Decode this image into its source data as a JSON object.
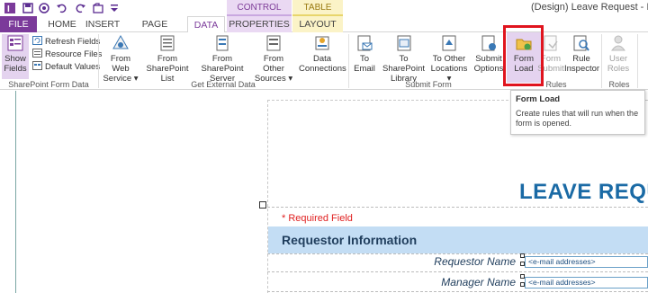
{
  "window": {
    "title": "(Design) Leave Request - Inf"
  },
  "contextual": {
    "control_tools": "CONTROL TOOLS",
    "table_tools": "TABLE TOOLS"
  },
  "tabs": {
    "file": "FILE",
    "home": "HOME",
    "insert": "INSERT",
    "page_design": "PAGE DESIGN",
    "data": "DATA",
    "properties": "PROPERTIES",
    "layout": "LAYOUT"
  },
  "ribbon": {
    "show_fields": [
      "Show",
      "Fields"
    ],
    "refresh_fields": "Refresh Fields",
    "resource_files": "Resource Files",
    "default_values": "Default Values",
    "group_sharepoint_form_data": "SharePoint Form Data",
    "from_web_service": [
      "From Web",
      "Service ▾"
    ],
    "from_sharepoint_list": [
      "From",
      "SharePoint List"
    ],
    "from_sharepoint_server": [
      "From SharePoint",
      "Server"
    ],
    "from_other_sources": [
      "From Other",
      "Sources ▾"
    ],
    "data_connections": [
      "Data",
      "Connections"
    ],
    "group_get_external_data": "Get External Data",
    "to_email": [
      "To",
      "Email"
    ],
    "to_sharepoint_library": [
      "To SharePoint",
      "Library"
    ],
    "to_other_locations": [
      "To Other",
      "Locations ▾"
    ],
    "submit_options": [
      "Submit",
      "Options"
    ],
    "group_submit_form": "Submit Form",
    "form_load": [
      "Form",
      "Load"
    ],
    "form_submit": [
      "Form",
      "Submit"
    ],
    "rule_inspector": [
      "Rule",
      "Inspector"
    ],
    "group_rules": "Rules",
    "user_roles": [
      "User",
      "Roles"
    ],
    "group_roles": "Roles"
  },
  "tooltip": {
    "title": "Form Load",
    "body": "Create rules that will run when the form is opened."
  },
  "form": {
    "title": "LEAVE REQU",
    "required_note": "* Required Field",
    "section_title": "Requestor Information",
    "fields": [
      {
        "label": "Requestor Name",
        "value": "<e-mail addresses>"
      },
      {
        "label": "Manager Name",
        "value": "<e-mail addresses>"
      }
    ]
  },
  "colors": {
    "file_tab": "#7b3a9a",
    "highlight": "#e0141e",
    "title_blue": "#1a6aa5",
    "section_bar": "#c3ddf4"
  }
}
